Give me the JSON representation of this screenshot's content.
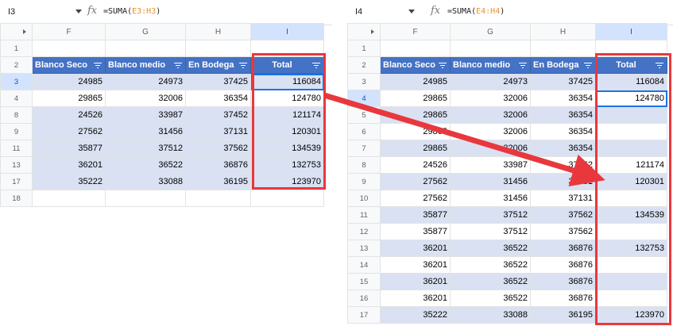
{
  "left": {
    "cell_ref": "I3",
    "formula_prefix": "=SUMA(",
    "formula_range": "E3:H3",
    "formula_suffix": ")",
    "fx_label": "fx",
    "columns": [
      "F",
      "G",
      "H",
      "I"
    ],
    "headers": [
      "Blanco Seco",
      "Blanco medio",
      "En Bodega",
      "Total"
    ],
    "rows": [
      {
        "num": "1",
        "cells": [
          "",
          "",
          "",
          ""
        ],
        "style": "blank"
      },
      {
        "num": "2",
        "cells": [],
        "style": "header"
      },
      {
        "num": "3",
        "cells": [
          "24985",
          "24973",
          "37425",
          "116084"
        ],
        "style": "band"
      },
      {
        "num": "4",
        "cells": [
          "29865",
          "32006",
          "36354",
          "124780"
        ],
        "style": "white"
      },
      {
        "num": "8",
        "cells": [
          "24526",
          "33987",
          "37452",
          "121174"
        ],
        "style": "band"
      },
      {
        "num": "9",
        "cells": [
          "27562",
          "31456",
          "37131",
          "120301"
        ],
        "style": "band"
      },
      {
        "num": "11",
        "cells": [
          "35877",
          "37512",
          "37562",
          "134539"
        ],
        "style": "band"
      },
      {
        "num": "13",
        "cells": [
          "36201",
          "36522",
          "36876",
          "132753"
        ],
        "style": "band"
      },
      {
        "num": "17",
        "cells": [
          "35222",
          "33088",
          "36195",
          "123970"
        ],
        "style": "band"
      },
      {
        "num": "18",
        "cells": [
          "",
          "",
          "",
          ""
        ],
        "style": "blank"
      }
    ]
  },
  "right": {
    "cell_ref": "I4",
    "formula_prefix": "=SUMA(",
    "formula_range": "E4:H4",
    "formula_suffix": ")",
    "fx_label": "fx",
    "columns": [
      "F",
      "G",
      "H",
      "I"
    ],
    "headers": [
      "Blanco Seco",
      "Blanco medio",
      "En Bodega",
      "Total"
    ],
    "rows": [
      {
        "num": "1",
        "cells": [
          "",
          "",
          "",
          ""
        ],
        "style": "blank"
      },
      {
        "num": "2",
        "cells": [],
        "style": "header"
      },
      {
        "num": "3",
        "cells": [
          "24985",
          "24973",
          "37425",
          "116084"
        ],
        "style": "band"
      },
      {
        "num": "4",
        "cells": [
          "29865",
          "32006",
          "36354",
          "124780"
        ],
        "style": "white"
      },
      {
        "num": "5",
        "cells": [
          "29865",
          "32006",
          "36354",
          ""
        ],
        "style": "band"
      },
      {
        "num": "6",
        "cells": [
          "29865",
          "32006",
          "36354",
          ""
        ],
        "style": "white"
      },
      {
        "num": "7",
        "cells": [
          "29865",
          "32006",
          "36354",
          ""
        ],
        "style": "band"
      },
      {
        "num": "8",
        "cells": [
          "24526",
          "33987",
          "37452",
          "121174"
        ],
        "style": "white"
      },
      {
        "num": "9",
        "cells": [
          "27562",
          "31456",
          "37131",
          "120301"
        ],
        "style": "band"
      },
      {
        "num": "10",
        "cells": [
          "27562",
          "31456",
          "37131",
          ""
        ],
        "style": "white"
      },
      {
        "num": "11",
        "cells": [
          "35877",
          "37512",
          "37562",
          "134539"
        ],
        "style": "band"
      },
      {
        "num": "12",
        "cells": [
          "35877",
          "37512",
          "37562",
          ""
        ],
        "style": "white"
      },
      {
        "num": "13",
        "cells": [
          "36201",
          "36522",
          "36876",
          "132753"
        ],
        "style": "band"
      },
      {
        "num": "14",
        "cells": [
          "36201",
          "36522",
          "36876",
          ""
        ],
        "style": "white"
      },
      {
        "num": "15",
        "cells": [
          "36201",
          "36522",
          "36876",
          ""
        ],
        "style": "band"
      },
      {
        "num": "16",
        "cells": [
          "36201",
          "36522",
          "36876",
          ""
        ],
        "style": "white"
      },
      {
        "num": "17",
        "cells": [
          "35222",
          "33088",
          "36195",
          "123970"
        ],
        "style": "band"
      }
    ]
  },
  "colors": {
    "header_fill": "#4472c4",
    "band_fill": "#d9e1f2",
    "highlight_red": "#e8383d",
    "selection_blue": "#1a73e8"
  }
}
